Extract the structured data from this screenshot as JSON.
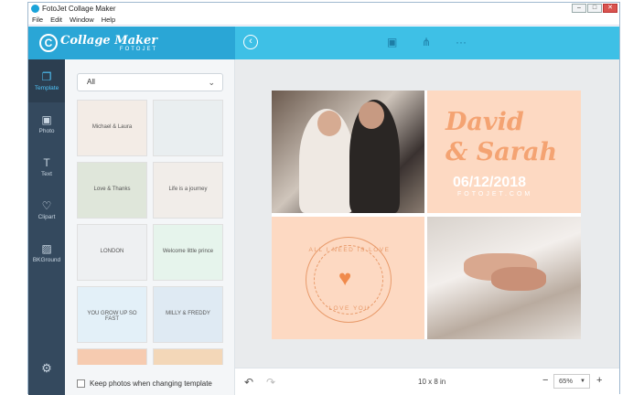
{
  "window": {
    "title": "FotoJet Collage Maker",
    "controls": [
      "–",
      "□",
      "✕"
    ]
  },
  "menu": [
    "File",
    "Edit",
    "Window",
    "Help"
  ],
  "header": {
    "logo_main": "Collage Maker",
    "logo_sub": "FOTOJET",
    "back_icon": "back-arrow-icon",
    "save_icon": "save-icon",
    "share_icon": "share-icon",
    "more_icon": "more-icon"
  },
  "sidenav": [
    {
      "label": "Template",
      "icon": "template-icon",
      "glyph": "❐",
      "active": true
    },
    {
      "label": "Photo",
      "icon": "photo-icon",
      "glyph": "▣",
      "active": false
    },
    {
      "label": "Text",
      "icon": "text-icon",
      "glyph": "T",
      "active": false
    },
    {
      "label": "Clipart",
      "icon": "clipart-icon",
      "glyph": "♡",
      "active": false
    },
    {
      "label": "BKGround",
      "icon": "background-icon",
      "glyph": "▨",
      "active": false
    }
  ],
  "settings_icon": "gear-icon",
  "panel": {
    "filter_value": "All",
    "keep_photos_label": "Keep photos when changing template",
    "thumbnails": [
      {
        "name": "template-wedding-names",
        "text": "Michael & Laura",
        "bg": "#f3ece6"
      },
      {
        "name": "template-wedding-blue",
        "text": "",
        "bg": "#e9eef0"
      },
      {
        "name": "template-love-thanks",
        "text": "Love & Thanks",
        "bg": "#dfe6da"
      },
      {
        "name": "template-journey",
        "text": "Life is a journey",
        "bg": "#f1ede9"
      },
      {
        "name": "template-london",
        "text": "LONDON",
        "bg": "#eef0f2"
      },
      {
        "name": "template-baby-prince",
        "text": "Welcome little prince",
        "bg": "#e6f4ec"
      },
      {
        "name": "template-grow-up",
        "text": "YOU GROW UP SO FAST",
        "bg": "#e3f0f8"
      },
      {
        "name": "template-milly-freddy",
        "text": "MILLY & FREDDY",
        "bg": "#dfeaf3"
      },
      {
        "name": "template-orange-1",
        "text": "",
        "bg": "#f6cbb0"
      },
      {
        "name": "template-orange-2",
        "text": "",
        "bg": "#f3d7b8"
      }
    ]
  },
  "collage": {
    "names_line1": "David",
    "names_line2": "& Sarah",
    "date": "06/12/2018",
    "brand": "FOTOJET.COM",
    "badge_top": "ALL I NEED IS LOVE",
    "badge_bottom": "LOVE YOU",
    "accent_color": "#f4a372",
    "panel_color": "#fdd9c2"
  },
  "bottombar": {
    "undo_icon": "undo-icon",
    "redo_icon": "redo-icon",
    "size": "10 x 8 in",
    "zoom_minus": "−",
    "zoom": "65%",
    "zoom_plus": "+"
  }
}
